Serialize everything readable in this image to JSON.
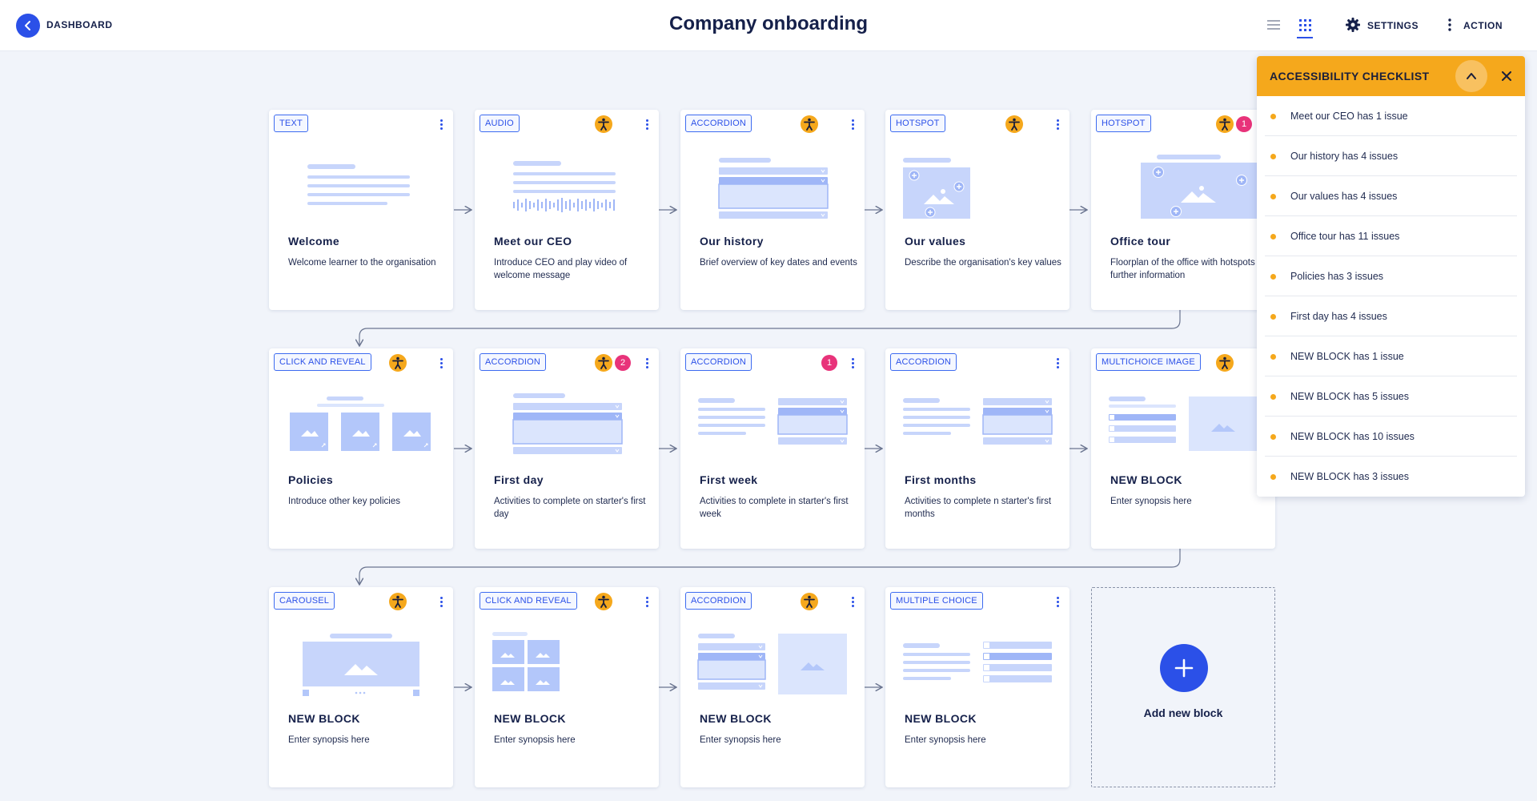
{
  "header": {
    "back_label": "DASHBOARD",
    "title": "Company onboarding",
    "settings_label": "SETTINGS",
    "action_label": "ACTION"
  },
  "cards": [
    {
      "tag": "TEXT",
      "title": "Welcome",
      "desc": "Welcome learner to the organisation",
      "a11y": false,
      "issues": null,
      "illustration": "text-lines"
    },
    {
      "tag": "AUDIO",
      "title": "Meet our CEO",
      "desc": "Introduce CEO and play video of welcome message",
      "a11y": true,
      "issues": null,
      "illustration": "audio-wave"
    },
    {
      "tag": "ACCORDION",
      "title": "Our history",
      "desc": "Brief overview of key dates and events",
      "a11y": true,
      "issues": null,
      "illustration": "accordion"
    },
    {
      "tag": "HOTSPOT",
      "title": "Our values",
      "desc": "Describe the organisation's key values",
      "a11y": true,
      "issues": null,
      "illustration": "hotspot-small"
    },
    {
      "tag": "HOTSPOT",
      "title": "Office tour",
      "desc": "Floorplan of the office with hotspots for further information",
      "a11y": true,
      "issues": "1",
      "illustration": "hotspot-large"
    },
    {
      "tag": "CLICK AND REVEAL",
      "title": "Policies",
      "desc": "Introduce other key policies",
      "a11y": true,
      "issues": null,
      "illustration": "click-reveal-row"
    },
    {
      "tag": "ACCORDION",
      "title": "First day",
      "desc": "Activities to complete on starter's first day",
      "a11y": true,
      "issues": "2",
      "illustration": "accordion-wide"
    },
    {
      "tag": "ACCORDION",
      "title": "First week",
      "desc": "Activities to complete in starter's first week",
      "a11y": false,
      "issues": "1",
      "illustration": "text-accordion"
    },
    {
      "tag": "ACCORDION",
      "title": "First months",
      "desc": "Activities to complete n starter's first months",
      "a11y": false,
      "issues": null,
      "illustration": "text-accordion"
    },
    {
      "tag": "MULTICHOICE IMAGE",
      "title": "NEW BLOCK",
      "desc": "Enter synopsis here",
      "a11y": true,
      "issues": null,
      "illustration": "multichoice-image"
    },
    {
      "tag": "CAROUSEL",
      "title": "NEW BLOCK",
      "desc": "Enter synopsis here",
      "a11y": true,
      "issues": null,
      "illustration": "carousel"
    },
    {
      "tag": "CLICK AND REVEAL",
      "title": "NEW BLOCK",
      "desc": "Enter synopsis here",
      "a11y": true,
      "issues": null,
      "illustration": "click-reveal-grid"
    },
    {
      "tag": "ACCORDION",
      "title": "NEW BLOCK",
      "desc": "Enter synopsis here",
      "a11y": true,
      "issues": null,
      "illustration": "accordion-image"
    },
    {
      "tag": "MULTIPLE CHOICE",
      "title": "NEW BLOCK",
      "desc": "Enter synopsis here",
      "a11y": false,
      "issues": null,
      "illustration": "multiple-choice"
    }
  ],
  "add_block_label": "Add new block",
  "checklist": {
    "title": "ACCESSIBILITY CHECKLIST",
    "items": [
      "Meet our CEO has 1 issue",
      "Our history has 4 issues",
      "Our values has 4 issues",
      "Office tour has 11 issues",
      "Policies has 3 issues",
      "First day has 4 issues",
      "NEW BLOCK has 1 issue",
      "NEW BLOCK has 5 issues",
      "NEW BLOCK has 10 issues",
      "NEW BLOCK has 3 issues"
    ]
  },
  "colors": {
    "accent": "#2b50e8",
    "warning": "#f5a81c",
    "danger": "#e8337a",
    "illustration": "#c7d5fb"
  }
}
